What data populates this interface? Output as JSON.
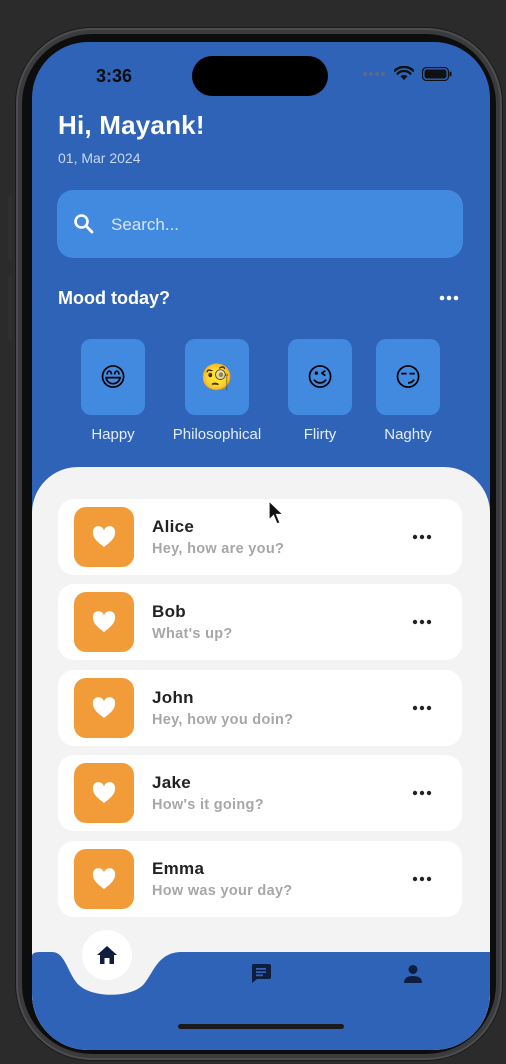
{
  "status_bar": {
    "time": "3:36"
  },
  "header": {
    "greeting": "Hi, Mayank!",
    "date": "01, Mar 2024"
  },
  "search": {
    "placeholder": "Search...",
    "icon": "search-icon"
  },
  "mood": {
    "title": "Mood today?",
    "options": [
      {
        "label": "Happy",
        "emoji": "😄"
      },
      {
        "label": "Philosophical",
        "emoji": "🧐"
      },
      {
        "label": "Flirty",
        "emoji": "😉"
      },
      {
        "label": "Naghty",
        "emoji": "😏"
      }
    ]
  },
  "chats": [
    {
      "name": "Alice",
      "message": "Hey, how are you?"
    },
    {
      "name": "Bob",
      "message": "What's up?"
    },
    {
      "name": "John",
      "message": "Hey, how you doin?"
    },
    {
      "name": "Jake",
      "message": "How's it going?"
    },
    {
      "name": "Emma",
      "message": "How was your day?"
    }
  ],
  "bottom_nav": {
    "items": [
      {
        "icon": "home-icon",
        "active": true
      },
      {
        "icon": "chat-icon",
        "active": false
      },
      {
        "icon": "person-icon",
        "active": false
      }
    ]
  },
  "colors": {
    "primary": "#2e63b8",
    "accent": "#4289e0",
    "avatar": "#f19c38",
    "sheet": "#f3f3f3",
    "nav_icon": "#0e1e3c"
  }
}
